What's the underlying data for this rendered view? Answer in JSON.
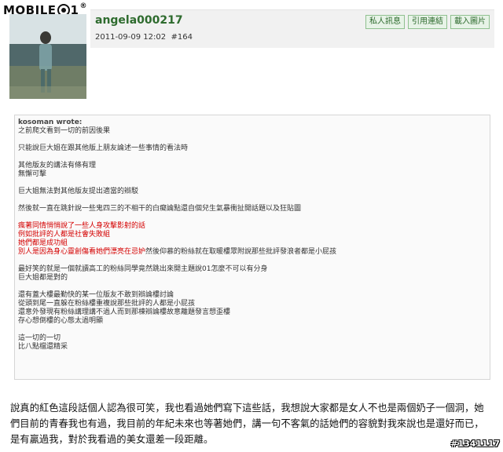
{
  "logo": {
    "pre": "MOBILE",
    "post": "1",
    "mark": "®"
  },
  "post": {
    "username": "angela000217",
    "datetime": "2011-09-09 12:02",
    "floor": "#164",
    "actions": [
      "私人訊息",
      "引用連結",
      "載入圖片"
    ]
  },
  "quote": {
    "author": "kosoman wrote:",
    "paragraphs": [
      [
        "之前爬文看到一切的前因後果"
      ],
      [
        "只能說巨大姐在跟其他版上朋友論述一些事情的看法時"
      ],
      [
        "其他版友的講法有條有理",
        "無懈可擊"
      ],
      [
        "巨大姐無法對其他版友提出適當的辯駁"
      ],
      [
        "然後就一直在跳針說一些鬼四三的不相干的白癡論點還自個兒生氣暴衝扯開話題以及狂貼圖"
      ],
      [
        "red:瘋著同情悄悄說了一些人身攻擊影射的話",
        "red:例如批評的人都是社會失敗組",
        "red:她們都是成功組",
        "mix:別人是因為身心靈創傷看她們漂亮在忌妒|然後仰慕的粉絲就在取暖樓眾附說那些批評發浪者都是小屁孩"
      ],
      [
        "最好笑的就是一個就讀高工的粉絲同學竟然跳出來開主題說01怎麼不可以有分身",
        "巨大姐都是對的"
      ],
      [
        "還有蓋大樓最勤快的某一位版友不敢到辯論樓討論",
        "從頭到尾一直躲在粉絲樓重複說那些批評的人都是小屁孩",
        "還意外發現有粉絲講理講不過人而到那棟辯論樓故意離題發言想歪樓",
        "存心想倒樓的心態太過明顯"
      ],
      [
        "這一切的一切",
        "比八點檔還精采"
      ]
    ]
  },
  "body": "說真的紅色這段話個人認為很可笑，我也看過她們寫下這些話，我想說大家都是女人不也是兩個奶子一個洞，她們目前的青春我也有過，我目前的年紀未來也等著她們，講一句不客氣的話她們的容貌對我來說也是還好而已，是有贏過我，對於我看過的美女還差一段距離。",
  "postid": "#1341117"
}
